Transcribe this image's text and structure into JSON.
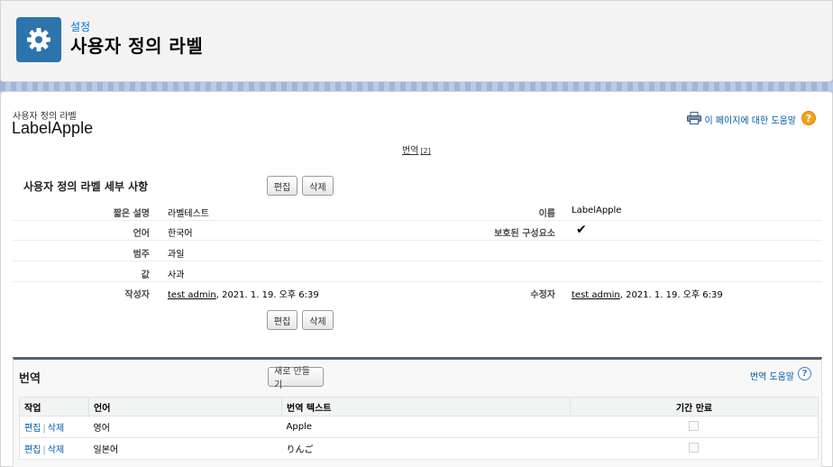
{
  "header": {
    "kicker": "설정",
    "title": "사용자 정의 라벨",
    "icon": "gear-icon",
    "icon_bg": "#2c74ac"
  },
  "record": {
    "type_label": "사용자 정의 라벨",
    "name": "LabelApple"
  },
  "help": {
    "link_text": "이 페이지에 대한 도움말",
    "print_icon": "printer-icon",
    "q": "?"
  },
  "related_links": {
    "translations_label": "번역",
    "translations_count": "[2]"
  },
  "detail": {
    "section_title": "사용자 정의 라벨 세부 사항",
    "edit_label": "편집",
    "delete_label": "삭제",
    "fields": {
      "short_desc_label": "짧은 설명",
      "short_desc_value": "라벨테스트",
      "name_label": "이름",
      "name_value": "LabelApple",
      "language_label": "언어",
      "language_value": "한국어",
      "protected_label": "보호된 구성요소",
      "protected_value": "✔",
      "category_label": "범주",
      "category_value": "과일",
      "value_label": "값",
      "value_value": "사과",
      "created_by_label": "작성자",
      "created_by_user": "test admin",
      "created_by_date": ", 2021. 1. 19. 오후 6:39",
      "modified_by_label": "수정자",
      "modified_by_user": "test admin",
      "modified_by_date": ", 2021. 1. 19. 오후 6:39"
    }
  },
  "translations": {
    "title": "번역",
    "new_button": "새로 만들기",
    "help_text": "번역 도움말",
    "q": "?",
    "columns": [
      "작업",
      "언어",
      "번역 텍스트",
      "기간 만료"
    ],
    "rows": [
      {
        "edit": "편집",
        "sep": "|",
        "delete": "삭제",
        "language": "영어",
        "text": "Apple",
        "expired": false
      },
      {
        "edit": "편집",
        "sep": "|",
        "delete": "삭제",
        "language": "일본어",
        "text": "りんご",
        "expired": false
      }
    ]
  }
}
